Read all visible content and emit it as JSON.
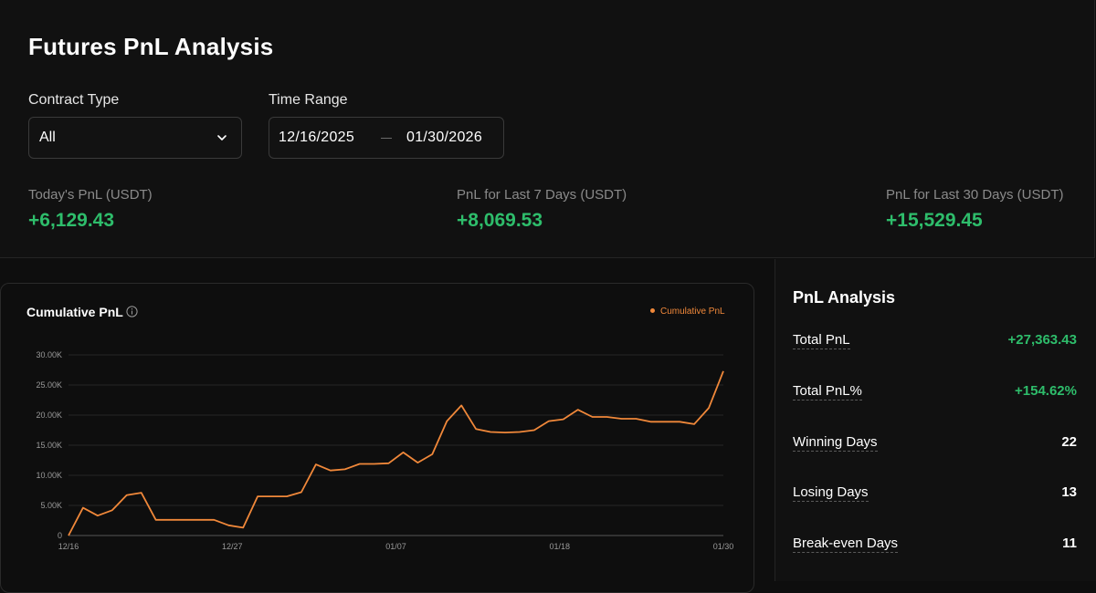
{
  "title": "Futures PnL Analysis",
  "filters": {
    "contract_type_label": "Contract Type",
    "contract_type_value": "All",
    "time_range_label": "Time Range",
    "start_date": "12/16/2025",
    "end_date": "01/30/2026"
  },
  "stats": [
    {
      "label": "Today's PnL (USDT)",
      "value": "+6,129.43"
    },
    {
      "label": "PnL for Last 7 Days (USDT)",
      "value": "+8,069.53"
    },
    {
      "label": "PnL for Last 30 Days (USDT)",
      "value": "+15,529.45"
    }
  ],
  "chart": {
    "title": "Cumulative PnL",
    "legend": "Cumulative PnL",
    "line_color": "#f0883a"
  },
  "chart_data": {
    "type": "line",
    "title": "Cumulative PnL",
    "x_ticks": [
      "12/16",
      "12/27",
      "01/07",
      "01/18",
      "01/30"
    ],
    "y_ticks": [
      "0",
      "5.00K",
      "10.00K",
      "15.00K",
      "20.00K",
      "25.00K",
      "30.00K"
    ],
    "ylim": [
      0,
      30000
    ],
    "grid": true,
    "legend_position": "top-right",
    "series": [
      {
        "name": "Cumulative PnL",
        "x": [
          "12/16",
          "12/17",
          "12/18",
          "12/19",
          "12/20",
          "12/21",
          "12/22",
          "12/23",
          "12/24",
          "12/25",
          "12/26",
          "12/27",
          "12/28",
          "12/29",
          "12/30",
          "12/31",
          "01/01",
          "01/02",
          "01/03",
          "01/04",
          "01/05",
          "01/06",
          "01/07",
          "01/08",
          "01/09",
          "01/10",
          "01/11",
          "01/12",
          "01/13",
          "01/14",
          "01/15",
          "01/16",
          "01/17",
          "01/18",
          "01/19",
          "01/20",
          "01/21",
          "01/22",
          "01/23",
          "01/24",
          "01/25",
          "01/26",
          "01/27",
          "01/28",
          "01/29",
          "01/30"
        ],
        "values": [
          0,
          4600,
          3300,
          4200,
          6700,
          7100,
          2600,
          2600,
          2600,
          2600,
          2600,
          1700,
          1300,
          6500,
          6500,
          6500,
          7200,
          11800,
          10800,
          11000,
          11900,
          11900,
          12000,
          13800,
          12100,
          13500,
          19000,
          21600,
          17700,
          17200,
          17100,
          17200,
          17500,
          19000,
          19300,
          20900,
          19700,
          19700,
          19400,
          19400,
          18900,
          18900,
          18900,
          18500,
          21200,
          27300
        ]
      }
    ]
  },
  "analysis": {
    "title": "PnL Analysis",
    "rows": [
      {
        "label": "Total PnL",
        "value": "+27,363.43"
      },
      {
        "label": "Total PnL%",
        "value": "+154.62%"
      },
      {
        "label": "Winning Days",
        "value": "22"
      },
      {
        "label": "Losing Days",
        "value": "13"
      },
      {
        "label": "Break-even Days",
        "value": "11"
      }
    ]
  },
  "colors": {
    "positive": "#2ebd6b",
    "accent": "#f0883a",
    "background": "#0e0e0e"
  }
}
